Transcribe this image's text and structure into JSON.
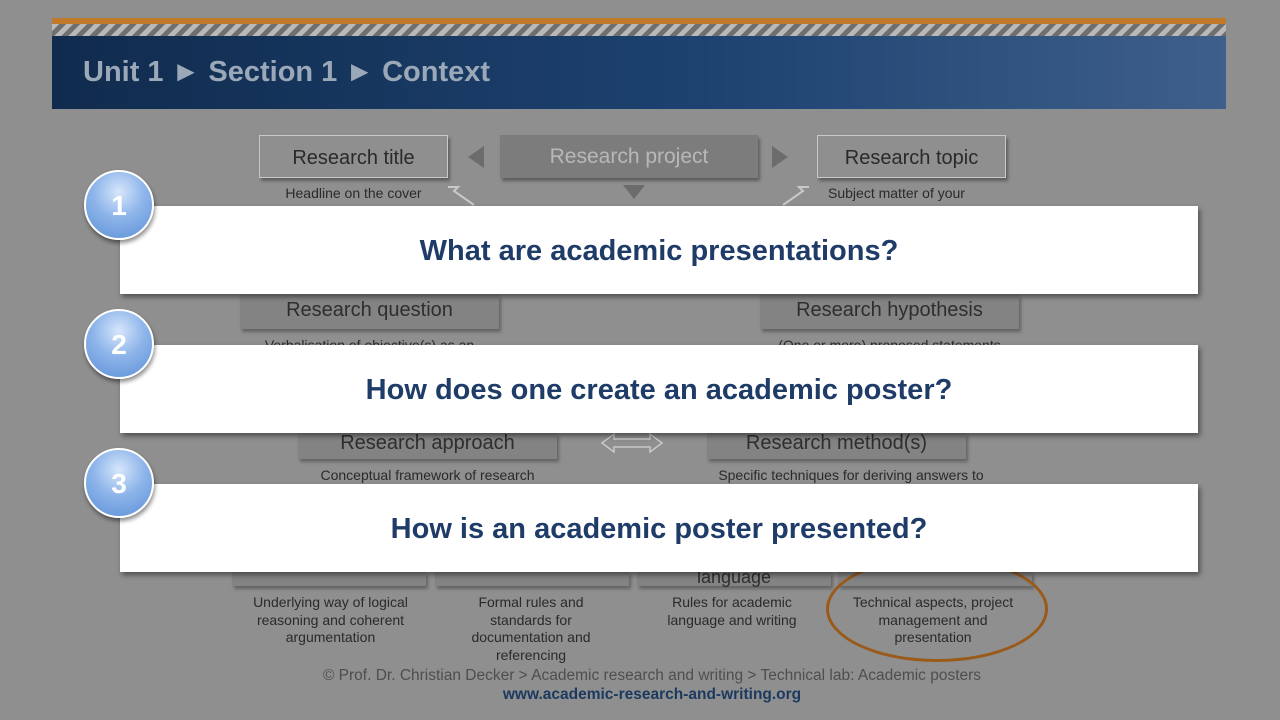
{
  "header": {
    "title": "Unit 1 ► Section 1 ► Context"
  },
  "diagram": {
    "research_title": {
      "label": "Research title",
      "desc": "Headline on the cover"
    },
    "research_project": {
      "label": "Research project"
    },
    "research_topic": {
      "label": "Research topic",
      "desc": "Subject matter of your"
    },
    "research_question": {
      "label": "Research question",
      "desc": "Verbalisation of objective(s) as an"
    },
    "research_hypothesis": {
      "label": "Research hypothesis",
      "desc": "(One or more) proposed statements"
    },
    "research_approach": {
      "label": "Research approach",
      "desc": "Conceptual framework of research"
    },
    "research_methods": {
      "label": "Research method(s)",
      "desc": "Specific techniques for deriving answers to"
    },
    "bottom": [
      {
        "label": "",
        "desc": "Underlying way of logical reasoning and coherent argumentation"
      },
      {
        "label": "",
        "desc": "Formal rules and standards for documentation and referencing"
      },
      {
        "label": "language",
        "desc": "Rules for academic language and writing"
      },
      {
        "label": "",
        "desc": "Technical aspects, project management and presentation"
      }
    ]
  },
  "footer": {
    "copyright": "© Prof. Dr. Christian Decker > Academic research and writing > Technical lab: Academic posters",
    "url": "www.academic-research-and-writing.org"
  },
  "questions": [
    {
      "number": "1",
      "text": "What are academic presentations?"
    },
    {
      "number": "2",
      "text": "How does one create an academic poster?"
    },
    {
      "number": "3",
      "text": "How is an academic poster presented?"
    }
  ]
}
